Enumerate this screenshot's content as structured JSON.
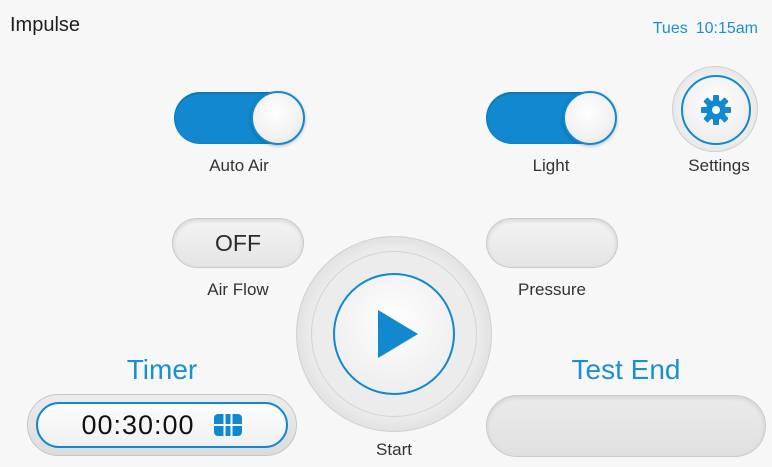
{
  "app": {
    "title": "Impulse"
  },
  "status": {
    "day": "Tues",
    "time": "10:15am"
  },
  "controls": {
    "auto_air": {
      "label": "Auto Air",
      "state": "on"
    },
    "light": {
      "label": "Light",
      "state": "on"
    },
    "settings": {
      "label": "Settings",
      "icon": "gear-icon"
    },
    "air_flow": {
      "label": "Air Flow",
      "value": "OFF"
    },
    "pressure": {
      "label": "Pressure",
      "value": ""
    },
    "start": {
      "label": "Start",
      "icon": "play-icon"
    }
  },
  "timer": {
    "title": "Timer",
    "value": "00:30:00",
    "icon": "keypad-icon"
  },
  "test_end": {
    "title": "Test End",
    "value": ""
  },
  "colors": {
    "accent": "#1188cf",
    "background": "#f7f7f7",
    "text": "#222222"
  }
}
